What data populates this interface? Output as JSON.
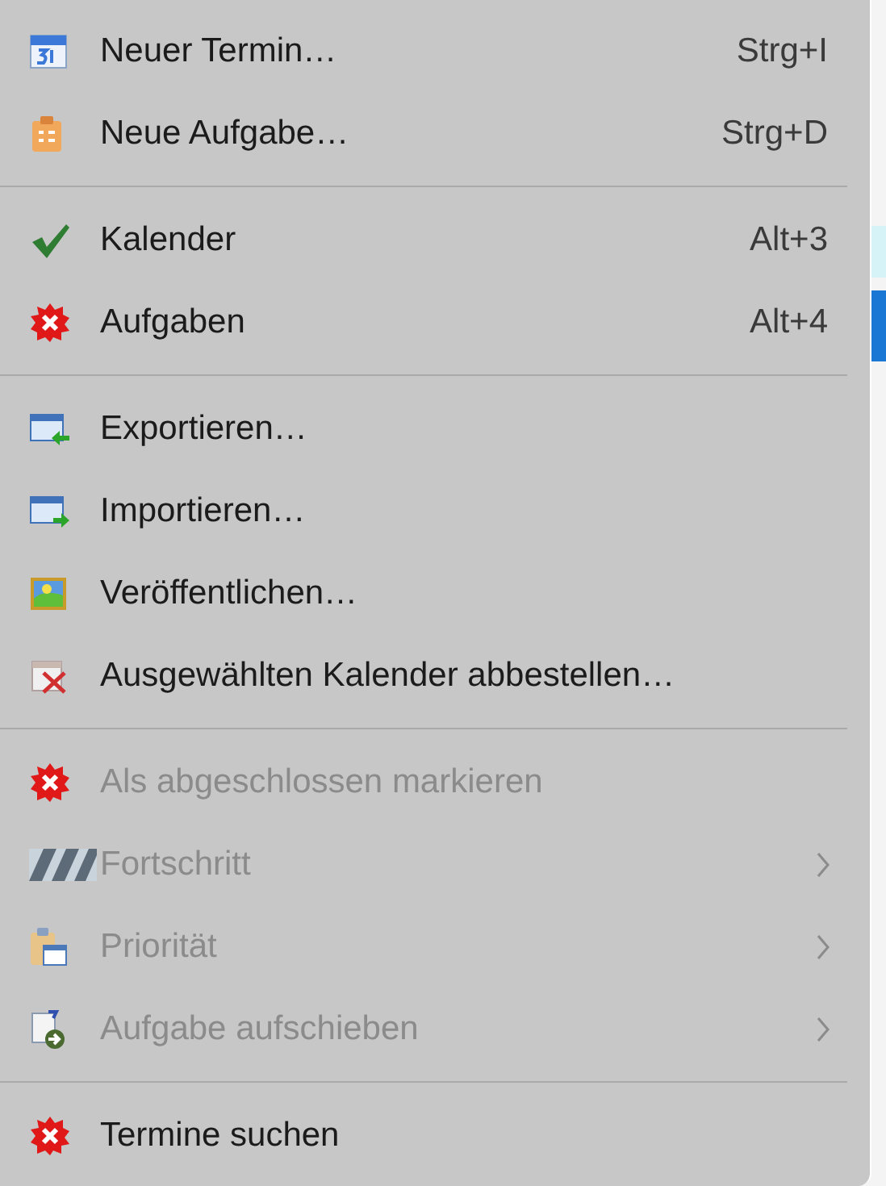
{
  "menu": {
    "groups": [
      {
        "items": [
          {
            "label": "Neuer Termin…",
            "shortcut": "Strg+I",
            "kind": "calendar",
            "disabled": false,
            "submenu": false
          },
          {
            "label": "Neue Aufgabe…",
            "shortcut": "Strg+D",
            "kind": "task",
            "disabled": false,
            "submenu": false
          }
        ]
      },
      {
        "items": [
          {
            "label": "Kalender",
            "shortcut": "Alt+3",
            "kind": "check",
            "disabled": false,
            "submenu": false
          },
          {
            "label": "Aufgaben",
            "shortcut": "Alt+4",
            "kind": "error",
            "disabled": false,
            "submenu": false
          }
        ]
      },
      {
        "items": [
          {
            "label": "Exportieren…",
            "kind": "export",
            "disabled": false,
            "submenu": false
          },
          {
            "label": "Importieren…",
            "kind": "import",
            "disabled": false,
            "submenu": false
          },
          {
            "label": "Veröffentlichen…",
            "kind": "publish",
            "disabled": false,
            "submenu": false
          },
          {
            "label": "Ausgewählten Kalender abbestellen…",
            "kind": "unsubscribe",
            "disabled": false,
            "submenu": false
          }
        ]
      },
      {
        "items": [
          {
            "label": "Als abgeschlossen markieren",
            "kind": "error",
            "disabled": true,
            "submenu": false
          },
          {
            "label": "Fortschritt",
            "kind": "progress",
            "disabled": true,
            "submenu": true
          },
          {
            "label": "Priorität",
            "kind": "priority",
            "disabled": true,
            "submenu": true
          },
          {
            "label": "Aufgabe aufschieben",
            "kind": "postpone",
            "disabled": true,
            "submenu": true
          }
        ]
      },
      {
        "items": [
          {
            "label": "Termine suchen",
            "kind": "error",
            "disabled": false,
            "submenu": false
          }
        ]
      }
    ]
  }
}
